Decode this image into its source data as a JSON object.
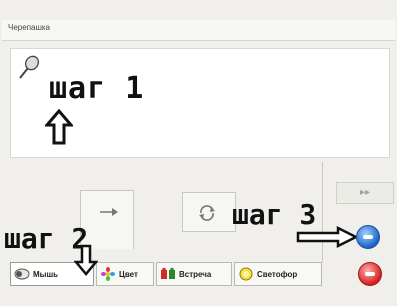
{
  "window": {
    "title": "Черепашка"
  },
  "canvas": {
    "annotation": "шаг 1"
  },
  "annotations": {
    "step2": "шаг 2",
    "step3": "шаг 3"
  },
  "controls": {
    "fast_forward_label": "▸▸"
  },
  "tabs": [
    {
      "label": "Мышь",
      "icon": "mouse-icon"
    },
    {
      "label": "Цвет",
      "icon": "color-icon"
    },
    {
      "label": "Встреча",
      "icon": "meeting-icon"
    },
    {
      "label": "Светофор",
      "icon": "traffic-light-icon"
    }
  ],
  "colors": {
    "accent_blue": "#1e63c8",
    "stop_red": "#d61e1e",
    "panel_bg": "#f0efeb"
  }
}
